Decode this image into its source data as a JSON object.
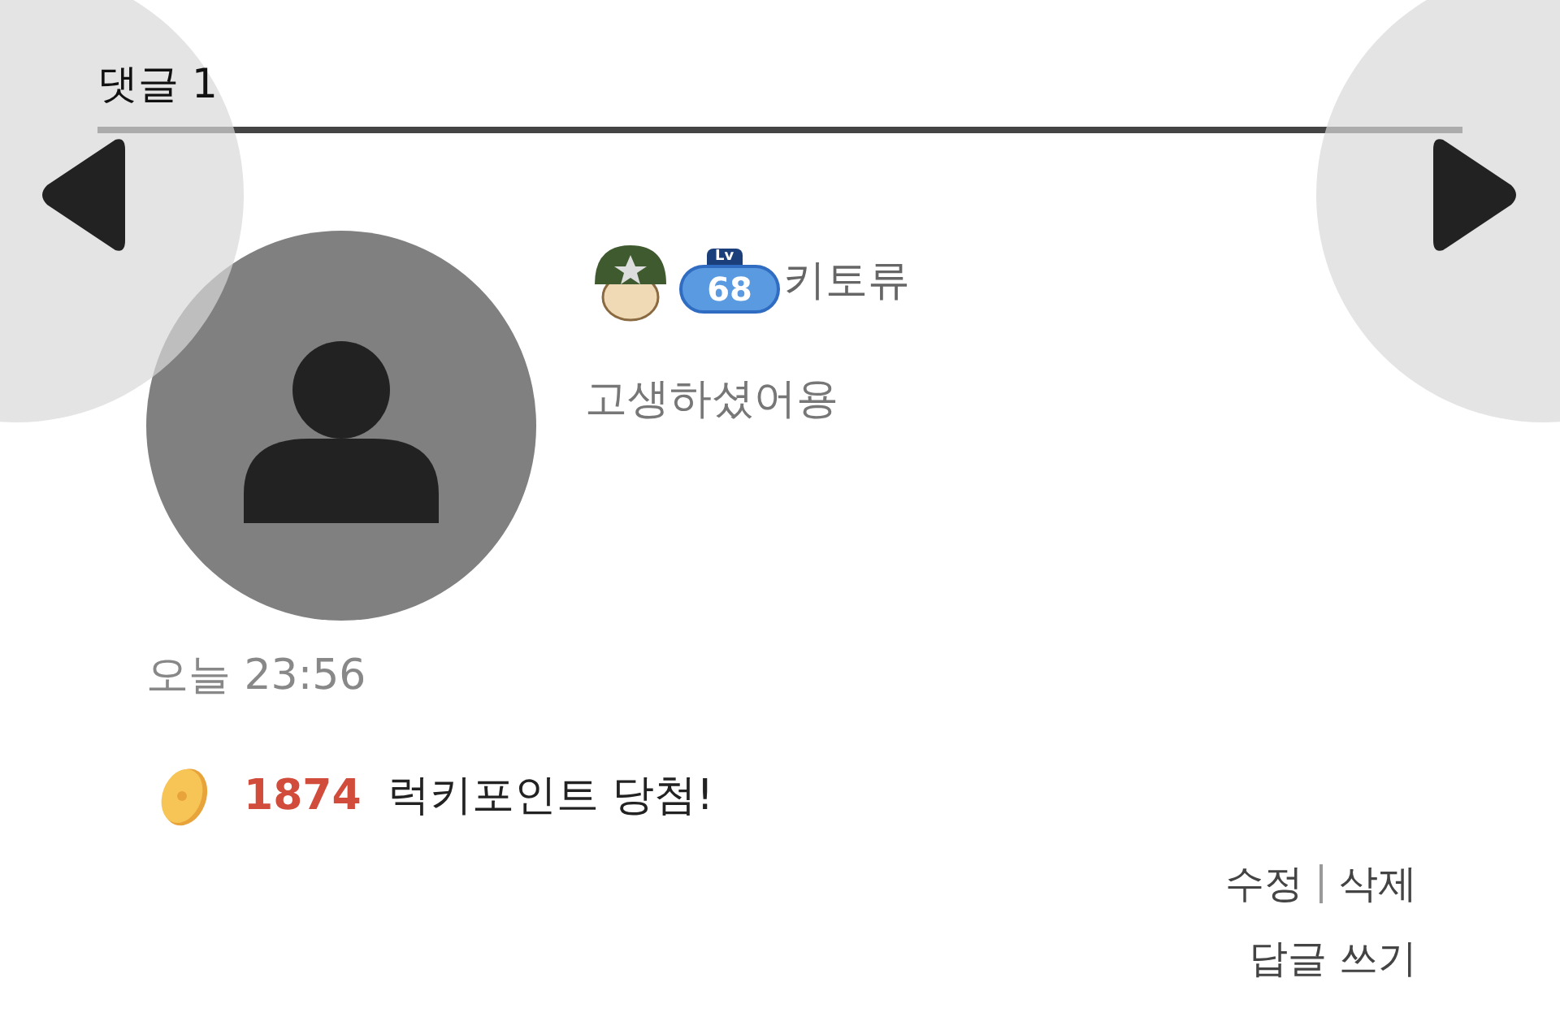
{
  "header": {
    "title": "댓글 1"
  },
  "comment": {
    "level_badge": {
      "prefix": "Lv",
      "level": "68"
    },
    "author": "키토류",
    "text": "고생하셨어용",
    "time": "오늘 23:56"
  },
  "lucky": {
    "points": "1874",
    "message": "럭키포인트 당첨!"
  },
  "actions": [
    {
      "label": "수정"
    },
    {
      "label": "삭제"
    }
  ],
  "reply_link": "답글 쓰기"
}
